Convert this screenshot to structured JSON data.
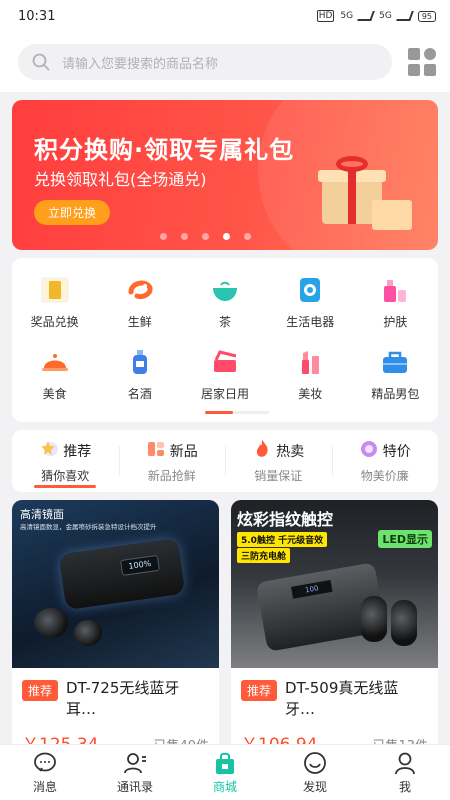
{
  "status_bar": {
    "time": "10:31",
    "network": "5G",
    "battery": "95"
  },
  "search": {
    "placeholder": "请输入您要搜索的商品名称"
  },
  "banner": {
    "title": "积分换购·领取专属礼包",
    "subtitle": "兑换领取礼包(全场通兑)",
    "button": "立即兑换",
    "page_count": 5,
    "active_page": 4
  },
  "categories": [
    {
      "label": "奖品兑换",
      "icon": "gold-bar-icon",
      "color": "#f0b72a"
    },
    {
      "label": "生鲜",
      "icon": "shrimp-icon",
      "color": "#ff6a2b"
    },
    {
      "label": "茶",
      "icon": "tea-bowl-icon",
      "color": "#2bc4b1"
    },
    {
      "label": "生活电器",
      "icon": "appliance-icon",
      "color": "#29a3e8"
    },
    {
      "label": "护肤",
      "icon": "skincare-icon",
      "color": "#ff4fa0"
    },
    {
      "label": "美食",
      "icon": "food-dome-icon",
      "color": "#ff6a2b"
    },
    {
      "label": "名酒",
      "icon": "bottle-icon",
      "color": "#3f7fe8"
    },
    {
      "label": "居家日用",
      "icon": "home-goods-icon",
      "color": "#ff4a6a"
    },
    {
      "label": "美妆",
      "icon": "lipstick-icon",
      "color": "#ff4a6a"
    },
    {
      "label": "精品男包",
      "icon": "bag-icon",
      "color": "#2e8ee8"
    }
  ],
  "tabs": [
    {
      "title": "推荐",
      "subtitle": "猜你喜欢",
      "icon": "star-icon",
      "color": "#f7c44a"
    },
    {
      "title": "新品",
      "subtitle": "新品抢鲜",
      "icon": "new-icon",
      "color": "#ff8a65"
    },
    {
      "title": "热卖",
      "subtitle": "销量保证",
      "icon": "fire-icon",
      "color": "#ff5a3a"
    },
    {
      "title": "特价",
      "subtitle": "物美价廉",
      "icon": "discount-icon",
      "color": "#c98bf2"
    }
  ],
  "products": [
    {
      "image_caption": "高清镜面",
      "image_small_text": "高清镜面数显，金属喷砂拆装急特设计档次提升",
      "screen_text": "100%",
      "badge": "推荐",
      "title": "DT-725无线蓝牙耳…",
      "price": "￥125.34",
      "sold": "已售40件"
    },
    {
      "image_caption": "炫彩指纹触控",
      "tag1": "5.0触控 千元级音效",
      "tag2": "三防充电舱",
      "tag3": "LED显示",
      "screen_text": "100",
      "badge": "推荐",
      "title": "DT-509真无线蓝牙…",
      "price": "￥106.94",
      "sold": "已售13件"
    }
  ],
  "bottom_nav": [
    {
      "label": "消息",
      "icon": "message-icon"
    },
    {
      "label": "通讯录",
      "icon": "contacts-icon"
    },
    {
      "label": "商城",
      "icon": "shop-bag-icon",
      "active": true
    },
    {
      "label": "发现",
      "icon": "discover-icon"
    },
    {
      "label": "我",
      "icon": "profile-icon"
    }
  ],
  "colors": {
    "accent": "#ff5a3a",
    "nav_active": "#17c3a3",
    "price": "#ff4d2a"
  }
}
